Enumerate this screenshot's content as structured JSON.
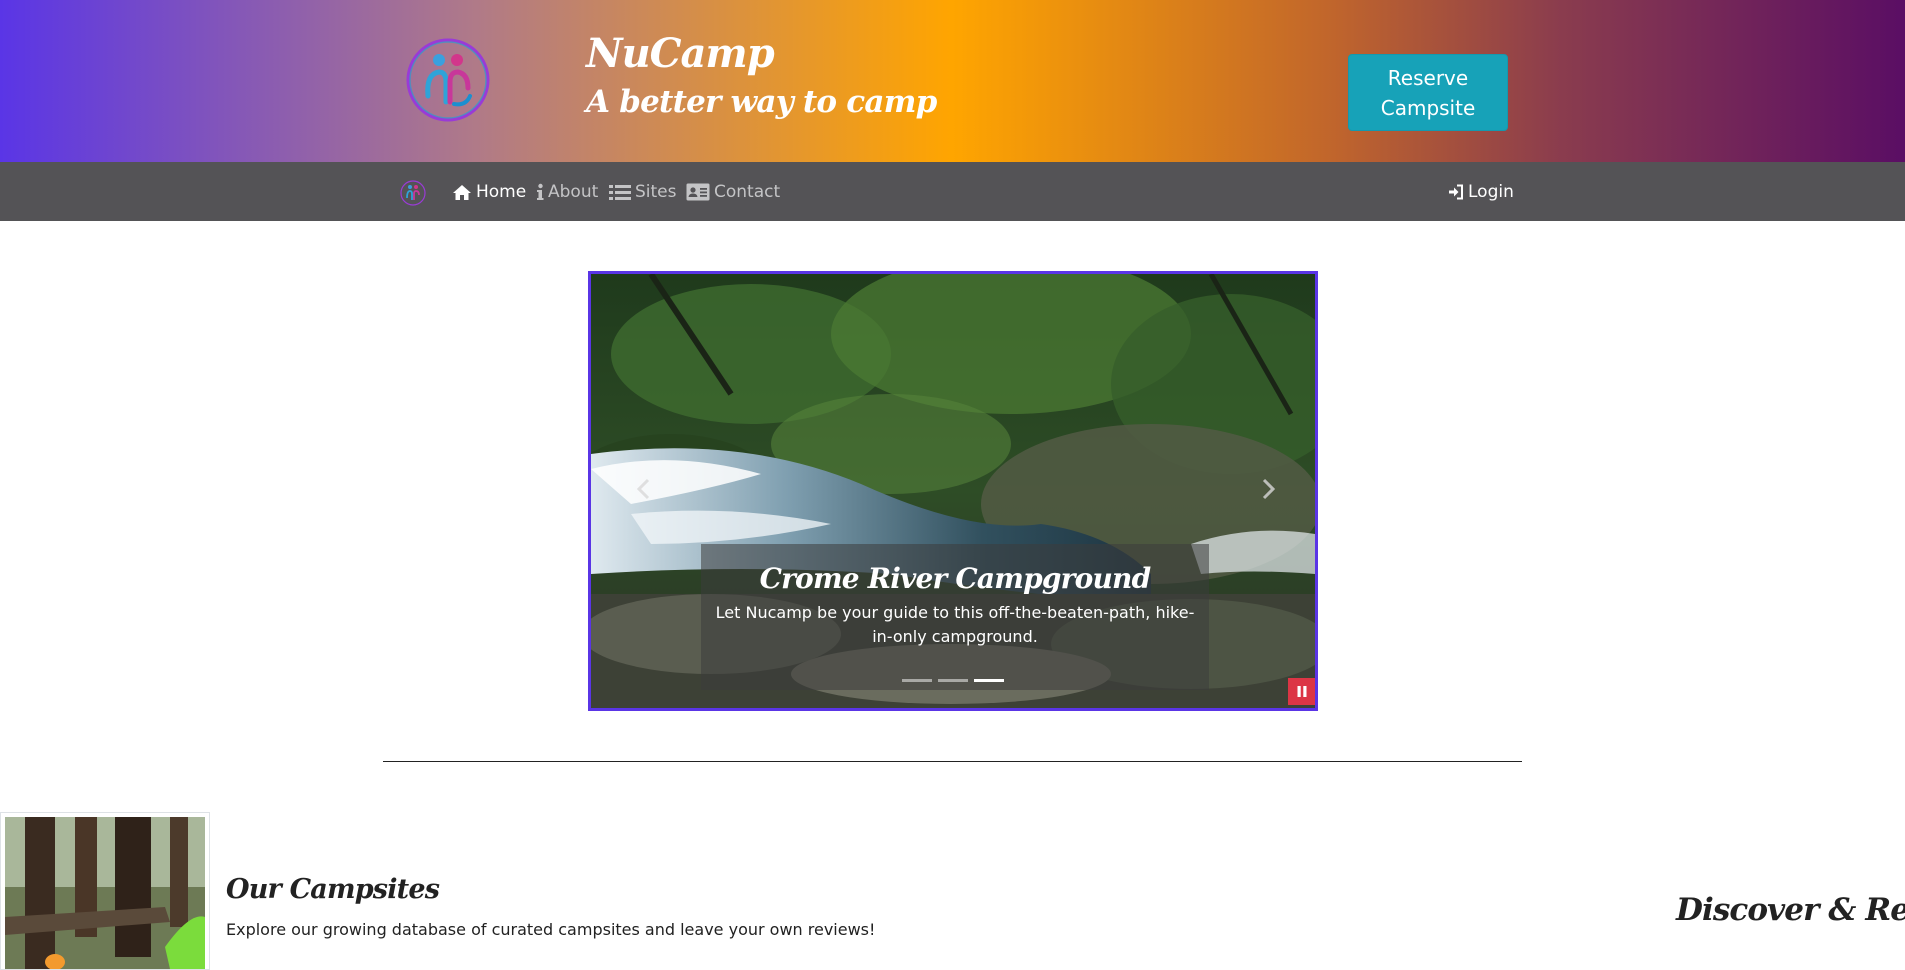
{
  "header": {
    "title": "NuCamp",
    "subtitle": "A better way to camp",
    "reserve_label": "Reserve Campsite"
  },
  "nav": {
    "items": [
      {
        "label": "Home",
        "icon": "home-icon",
        "active": true
      },
      {
        "label": "About",
        "icon": "info-icon",
        "active": false
      },
      {
        "label": "Sites",
        "icon": "list-icon",
        "active": false
      },
      {
        "label": "Contact",
        "icon": "address-card-icon",
        "active": false
      }
    ],
    "login_label": "Login"
  },
  "carousel": {
    "caption_title": "Crome River Campground",
    "caption_text": "Let Nucamp be your guide to this off-the-beaten-path, hike-in-only campground.",
    "indicator_count": 3,
    "active_index": 2
  },
  "section": {
    "title": "Our Campsites",
    "text": "Explore our growing database of curated campsites and leave your own reviews!",
    "side_heading": "Discover & Review"
  },
  "colors": {
    "accent": "#17a2b8",
    "navbar": "#545356",
    "carousel_border": "#5a35e6",
    "pause": "#dc3545"
  }
}
